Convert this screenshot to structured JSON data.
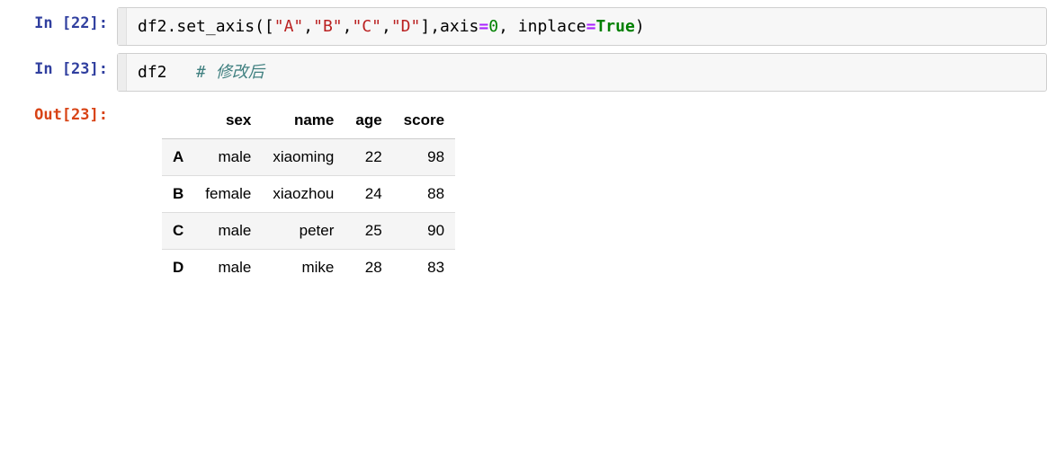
{
  "cells": [
    {
      "prompt_label": "In [22]:",
      "code_tokens": {
        "t0": "df2",
        "t1": ".",
        "t2": "set_axis",
        "t3": "(",
        "t4": "[",
        "t5": "\"A\"",
        "t6": ",",
        "t7": "\"B\"",
        "t8": ",",
        "t9": "\"C\"",
        "t10": ",",
        "t11": "\"D\"",
        "t12": "]",
        "t13": ",",
        "t14": "axis",
        "t15": "=",
        "t16": "0",
        "t17": ", ",
        "t18": "inplace",
        "t19": "=",
        "t20": "True",
        "t21": ")"
      }
    },
    {
      "prompt_label": "In [23]:",
      "code_tokens": {
        "t0": "df2",
        "t1": "   ",
        "t2": "# 修改后"
      }
    }
  ],
  "output_prompt": "Out[23]:",
  "dataframe": {
    "columns": [
      "sex",
      "name",
      "age",
      "score"
    ],
    "index": [
      "A",
      "B",
      "C",
      "D"
    ],
    "rows": [
      {
        "sex": "male",
        "name": "xiaoming",
        "age": "22",
        "score": "98"
      },
      {
        "sex": "female",
        "name": "xiaozhou",
        "age": "24",
        "score": "88"
      },
      {
        "sex": "male",
        "name": "peter",
        "age": "25",
        "score": "90"
      },
      {
        "sex": "male",
        "name": "mike",
        "age": "28",
        "score": "83"
      }
    ]
  }
}
